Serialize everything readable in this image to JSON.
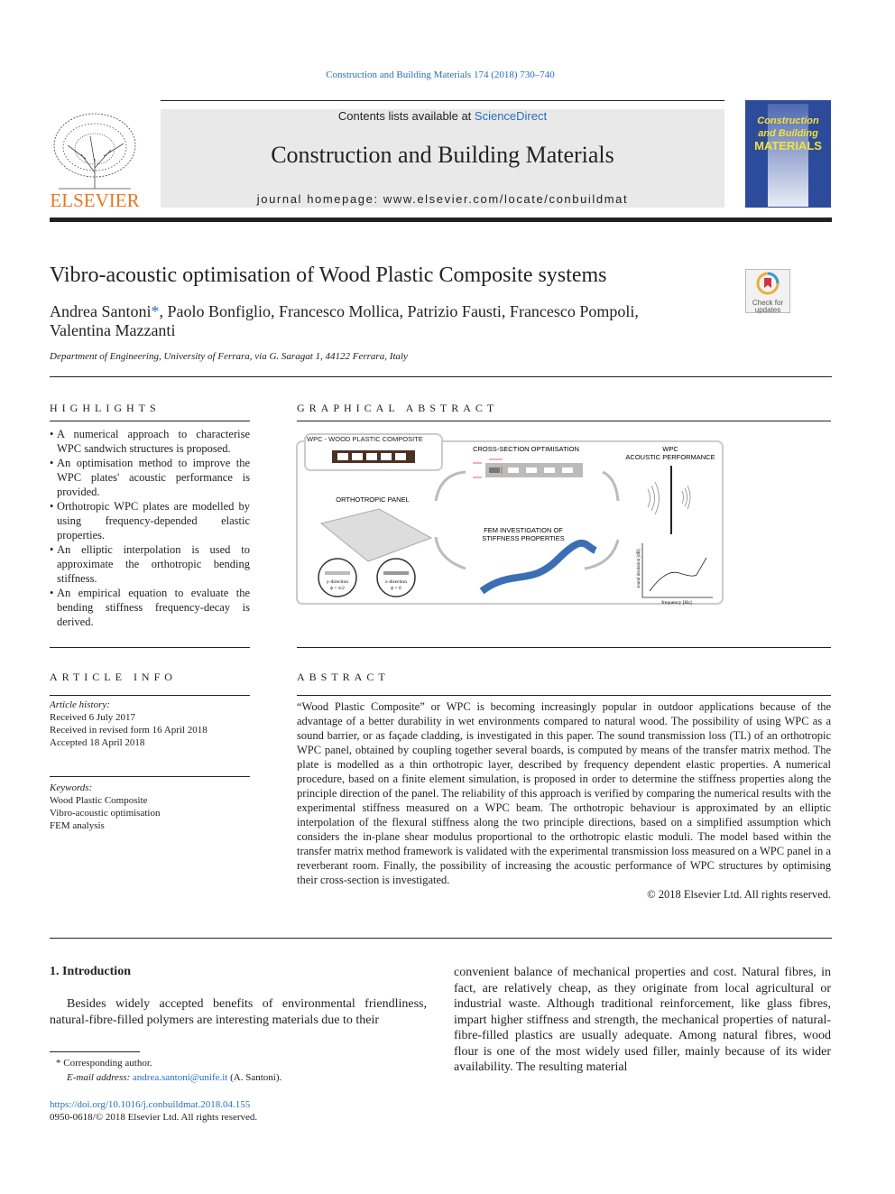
{
  "citation": "Construction and Building Materials 174 (2018) 730–740",
  "masthead": {
    "contents_prefix": "Contents lists available at ",
    "contents_link": "ScienceDirect",
    "journal_title": "Construction and Building Materials",
    "homepage": "journal homepage: www.elsevier.com/locate/conbuildmat"
  },
  "publisher_logo": "ELSEVIER",
  "cover": {
    "line1": "Construction",
    "line2": "and Building",
    "line3": "MATERIALS",
    "color": "#2d4b9b"
  },
  "check_updates": "Check for updates",
  "article": {
    "title": "Vibro-acoustic optimisation of Wood Plastic Composite systems",
    "author_first": "Andrea Santoni",
    "author_mark": "*",
    "authors_rest": ", Paolo Bonfiglio, Francesco Mollica, Patrizio Fausti, Francesco Pompoli,",
    "authors_line2": "Valentina Mazzanti",
    "affiliation": "Department of Engineering, University of Ferrara, via G. Saragat 1, 44122 Ferrara, Italy"
  },
  "highlights": {
    "heading": "HIGHLIGHTS",
    "items": [
      "A numerical approach to characterise WPC sandwich structures is proposed.",
      "An optimisation method to improve the WPC plates' acoustic performance is provided.",
      "Orthotropic WPC plates are modelled by using frequency-depended elastic properties.",
      "An elliptic interpolation is used to approximate the orthotropic bending stiffness.",
      "An empirical equation to evaluate the bending stiffness frequency-decay is derived."
    ]
  },
  "graphical_abstract": {
    "heading": "GRAPHICAL ABSTRACT",
    "wpc_label": "WPC - WOOD PLASTIC COMPOSITE",
    "cross_section": "CROSS-SECTION OPTIMISATION",
    "wpc_perf_1": "WPC",
    "wpc_perf_2": "ACOUSTIC PERFORMANCE",
    "ortho": "ORTHOTROPIC PANEL",
    "fem_1": "FEM INVESTIGATION OF",
    "fem_2": "STIFFNESS PROPERTIES",
    "ydir": "y-direction",
    "yphi": "ϕ = π/2",
    "xdir": "x-direction",
    "xphi": "ϕ = 0",
    "ylabel": "sound insulation [dB]",
    "xlabel": "frequency [Hz]"
  },
  "article_info": {
    "heading": "ARTICLE INFO",
    "history_label": "Article history:",
    "history": [
      "Received 6 July 2017",
      "Received in revised form 16 April 2018",
      "Accepted 18 April 2018"
    ],
    "keywords_label": "Keywords:",
    "keywords": [
      "Wood Plastic Composite",
      "Vibro-acoustic optimisation",
      "FEM analysis"
    ]
  },
  "abstract": {
    "heading": "ABSTRACT",
    "text": "“Wood Plastic Composite” or WPC is becoming increasingly popular in outdoor applications because of the advantage of a better durability in wet environments compared to natural wood. The possibility of using WPC as a sound barrier, or as façade cladding, is investigated in this paper. The sound transmission loss (TL) of an orthotropic WPC panel, obtained by coupling together several boards, is computed by means of the transfer matrix method. The plate is modelled as a thin orthotropic layer, described by frequency dependent elastic properties. A numerical procedure, based on a finite element simulation, is proposed in order to determine the stiffness properties along the principle direction of the panel. The reliability of this approach is verified by comparing the numerical results with the experimental stiffness measured on a WPC beam. The orthotropic behaviour is approximated by an elliptic interpolation of the flexural stiffness along the two principle directions, based on a simplified assumption which considers the in-plane shear modulus proportional to the orthotropic elastic moduli. The model based within the transfer matrix method framework is validated with the experimental transmission loss measured on a WPC panel in a reverberant room. Finally, the possibility of increasing the acoustic performance of WPC structures by optimising their cross-section is investigated.",
    "copyright": "© 2018 Elsevier Ltd. All rights reserved."
  },
  "intro": {
    "heading": "1. Introduction",
    "left": "Besides widely accepted benefits of environmental friendliness, natural-fibre-filled polymers are interesting materials due to their",
    "right": "convenient balance of mechanical properties and cost. Natural fibres, in fact, are relatively cheap, as they originate from local agricultural or industrial waste. Although traditional reinforcement, like glass fibres, impart higher stiffness and strength, the mechanical properties of natural-fibre-filled plastics are usually adequate. Among natural fibres, wood flour is one of the most widely used filler, mainly because of its wider availability. The resulting material"
  },
  "footnote": {
    "mark": "*",
    "text": "Corresponding author.",
    "email_label": "E-mail address:",
    "email": "andrea.santoni@unife.it",
    "email_suffix": " (A. Santoni)."
  },
  "doi": "https://doi.org/10.1016/j.conbuildmat.2018.04.155",
  "issn": "0950-0618/© 2018 Elsevier Ltd. All rights reserved."
}
